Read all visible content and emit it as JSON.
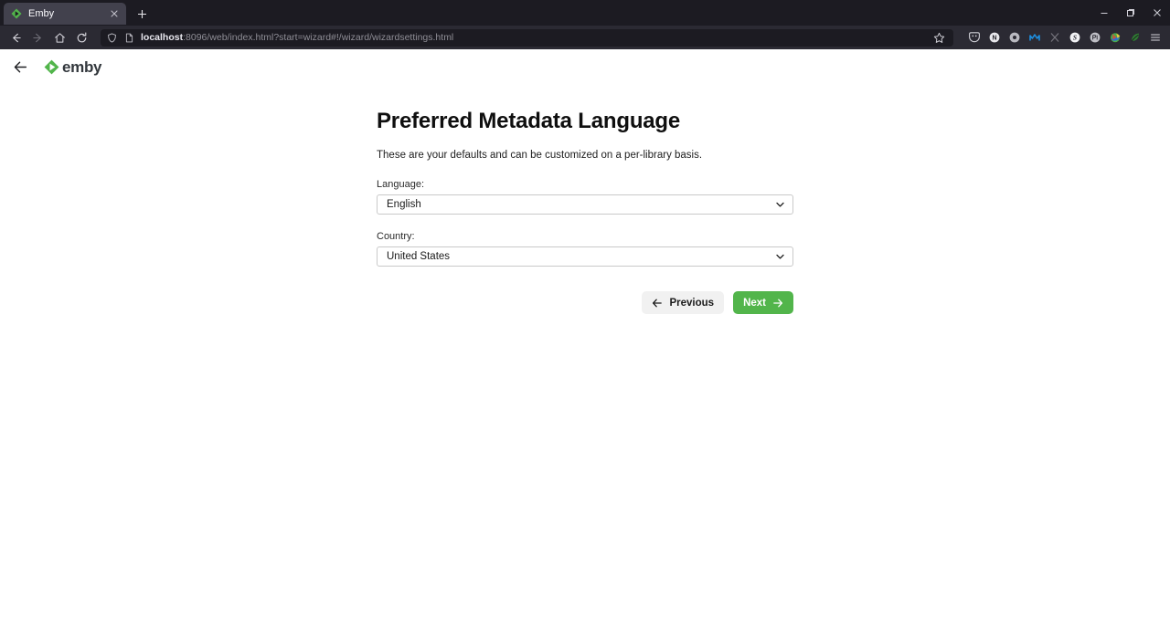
{
  "browser": {
    "tab": {
      "title": "Emby",
      "favicon_icon": "emby-diamond-icon",
      "close_icon": "close-icon"
    },
    "new_tab_icon": "plus-icon",
    "window_controls": {
      "minimize_icon": "minimize-icon",
      "maximize_icon": "maximize-icon",
      "close_icon": "window-close-icon"
    },
    "nav": {
      "back_icon": "arrow-left-icon",
      "forward_icon": "arrow-right-icon",
      "home_icon": "home-icon",
      "reload_icon": "reload-icon"
    },
    "urlbar": {
      "shield_icon": "shield-icon",
      "page_icon": "page-document-icon",
      "host": "localhost",
      "path": ":8096/web/index.html?start=wizard#!/wizard/wizardsettings.html",
      "full_url": "localhost:8096/web/index.html?start=wizard#!/wizard/wizardsettings.html",
      "bookmark_icon": "star-icon"
    },
    "extensions": [
      {
        "name": "pocket-icon",
        "color": "#cfcfd6"
      },
      {
        "name": "nightmode-icon",
        "color": "#e8e8ec"
      },
      {
        "name": "circle-extension-icon",
        "color": "#b9b9c0"
      },
      {
        "name": "malwarebytes-icon",
        "color": "#1e8fe0"
      },
      {
        "name": "x-extension-icon",
        "color": "#75747c"
      },
      {
        "name": "s-extension-icon",
        "color": "#f2f2f5"
      },
      {
        "name": "ublock-icon",
        "color": "#bfbfc6"
      },
      {
        "name": "colorzilla-icon",
        "color": "#4aa84a"
      },
      {
        "name": "leaf-extension-icon",
        "color": "#2f7d32"
      }
    ],
    "menu_icon": "hamburger-menu-icon"
  },
  "app": {
    "back_icon": "back-arrow-icon",
    "brand_name": "emby",
    "brand_mark_icon": "emby-logo-icon",
    "brand_color": "#52b54b"
  },
  "wizard": {
    "title": "Preferred Metadata Language",
    "subtitle": "These are your defaults and can be customized on a per-library basis.",
    "fields": [
      {
        "label": "Language:",
        "value": "English",
        "chevron_icon": "chevron-down-icon"
      },
      {
        "label": "Country:",
        "value": "United States",
        "chevron_icon": "chevron-down-icon"
      }
    ],
    "buttons": {
      "previous_label": "Previous",
      "previous_icon": "arrow-left-icon",
      "next_label": "Next",
      "next_icon": "arrow-right-icon"
    }
  }
}
